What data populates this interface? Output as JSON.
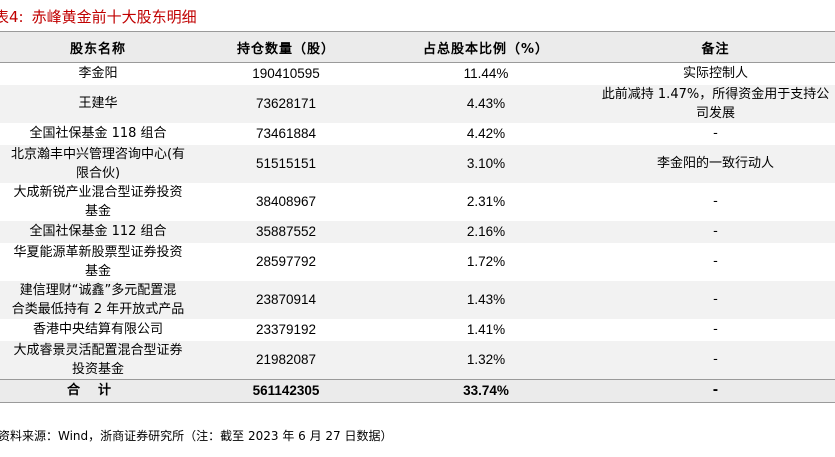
{
  "title": {
    "number": "表4:",
    "text": "赤峰黄金前十大股东明细"
  },
  "table": {
    "headers": [
      "股东名称",
      "持仓数量（股）",
      "占总股本比例（%）",
      "备注"
    ],
    "rows": [
      {
        "name": [
          "李金阳"
        ],
        "shares": "190410595",
        "ratio": "11.44%",
        "note": [
          "实际控制人"
        ]
      },
      {
        "name": [
          "王建华"
        ],
        "shares": "73628171",
        "ratio": "4.43%",
        "note": [
          "此前减持 1.47%，所得资金用于支持公",
          "司发展"
        ]
      },
      {
        "name": [
          "全国社保基金 118 组合"
        ],
        "shares": "73461884",
        "ratio": "4.42%",
        "note": [
          "-"
        ]
      },
      {
        "name": [
          "北京瀚丰中兴管理咨询中心(有",
          "限合伙)"
        ],
        "shares": "51515151",
        "ratio": "3.10%",
        "note": [
          "李金阳的一致行动人"
        ]
      },
      {
        "name": [
          "大成新锐产业混合型证券投资",
          "基金"
        ],
        "shares": "38408967",
        "ratio": "2.31%",
        "note": [
          "-"
        ]
      },
      {
        "name": [
          "全国社保基金 112 组合"
        ],
        "shares": "35887552",
        "ratio": "2.16%",
        "note": [
          "-"
        ]
      },
      {
        "name": [
          "华夏能源革新股票型证券投资",
          "基金"
        ],
        "shares": "28597792",
        "ratio": "1.72%",
        "note": [
          "-"
        ]
      },
      {
        "name": [
          "建信理财“诚鑫”多元配置混",
          "合类最低持有 2 年开放式产品"
        ],
        "shares": "23870914",
        "ratio": "1.43%",
        "note": [
          "-"
        ]
      },
      {
        "name": [
          "香港中央结算有限公司"
        ],
        "shares": "23379192",
        "ratio": "1.41%",
        "note": [
          "-"
        ]
      },
      {
        "name": [
          "大成睿景灵活配置混合型证券",
          "投资基金"
        ],
        "shares": "21982087",
        "ratio": "1.32%",
        "note": [
          "-"
        ]
      }
    ],
    "total": {
      "label": "合计",
      "shares": "561142305",
      "ratio": "33.74%",
      "note": "-"
    }
  },
  "source": "资料来源：Wind，浙商证券研究所（注：截至 2023 年 6 月 27 日数据）",
  "colors": {
    "title": "#c00000",
    "header_bg": "#ebebeb",
    "stripe_bg": "#f2f2f2",
    "rule": "#9a9a9a"
  }
}
